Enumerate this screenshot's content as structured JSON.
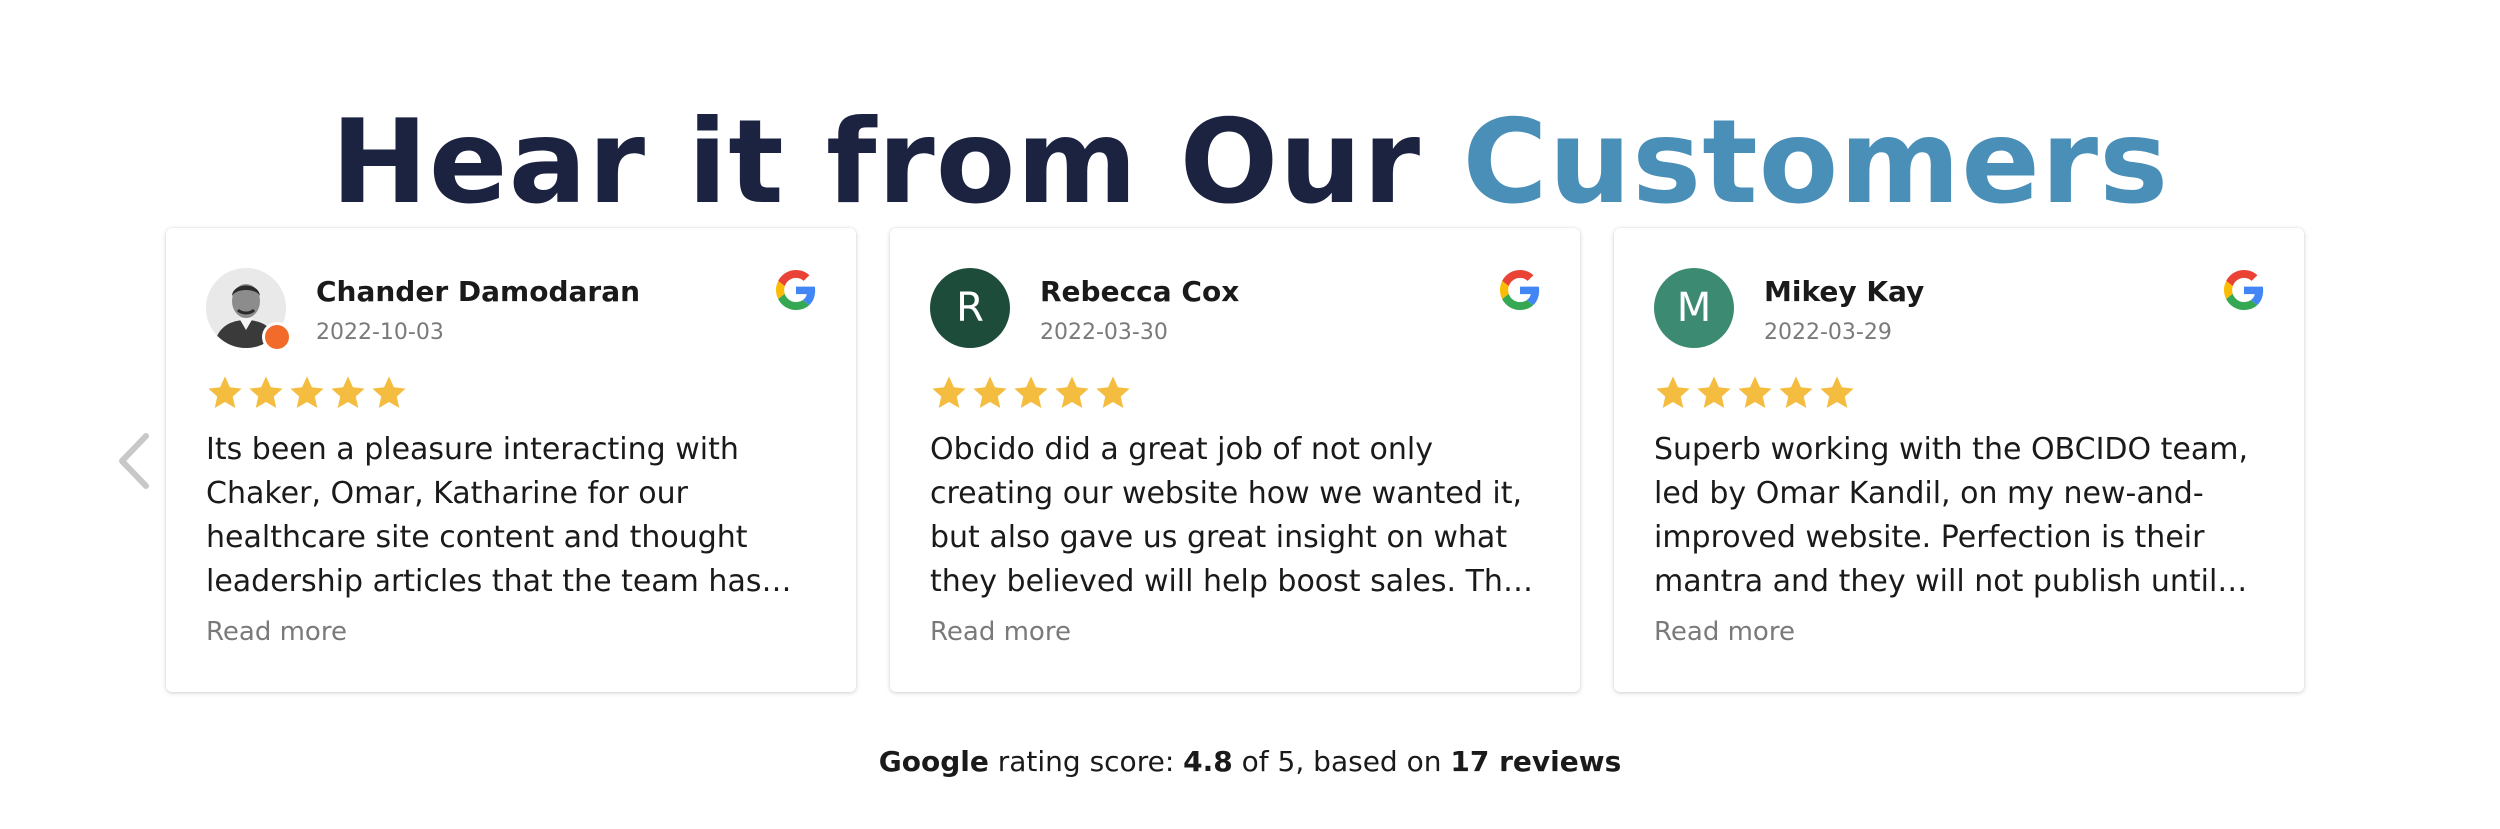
{
  "heading": {
    "part1": "Hear it from Our ",
    "part2": "Customers"
  },
  "colors": {
    "heading_dark": "#1c2340",
    "heading_accent": "#4a8fb8",
    "star": "#f4bd3f",
    "avatar_rebecca": "#1d4d3a",
    "avatar_mikey": "#3d8a72"
  },
  "icons": {
    "prev": "chevron-left-icon",
    "source": "google-icon",
    "rating": "star-icon"
  },
  "reviews": [
    {
      "name": "Chander Damodaran",
      "date": "2022-10-03",
      "rating": 5,
      "text": "Its been a pleasure interacting with Chaker, Omar, Katharine for our healthcare site content and thought leadership articles that the team has helped co-create. I wou...",
      "read_more": "Read more",
      "avatar_type": "photo"
    },
    {
      "name": "Rebecca Cox",
      "date": "2022-03-30",
      "rating": 5,
      "text": "Obcido did a great job of not only creating our website how we wanted it, but also gave us great insight on what they believed will help boost sales. The designers and...",
      "read_more": "Read more",
      "avatar_initial": "R"
    },
    {
      "name": "Mikey Kay",
      "date": "2022-03-29",
      "rating": 5,
      "text": "Superb working with the OBCIDO team, led by Omar Kandil, on my new-and-improved website. Perfection is their mantra and they will not publish until everything is...",
      "read_more": "Read more",
      "avatar_initial": "M"
    }
  ],
  "summary": {
    "source": "Google",
    "label": " rating score: ",
    "score": "4.8",
    "out_of": " of 5, based on ",
    "count": "17 reviews"
  }
}
